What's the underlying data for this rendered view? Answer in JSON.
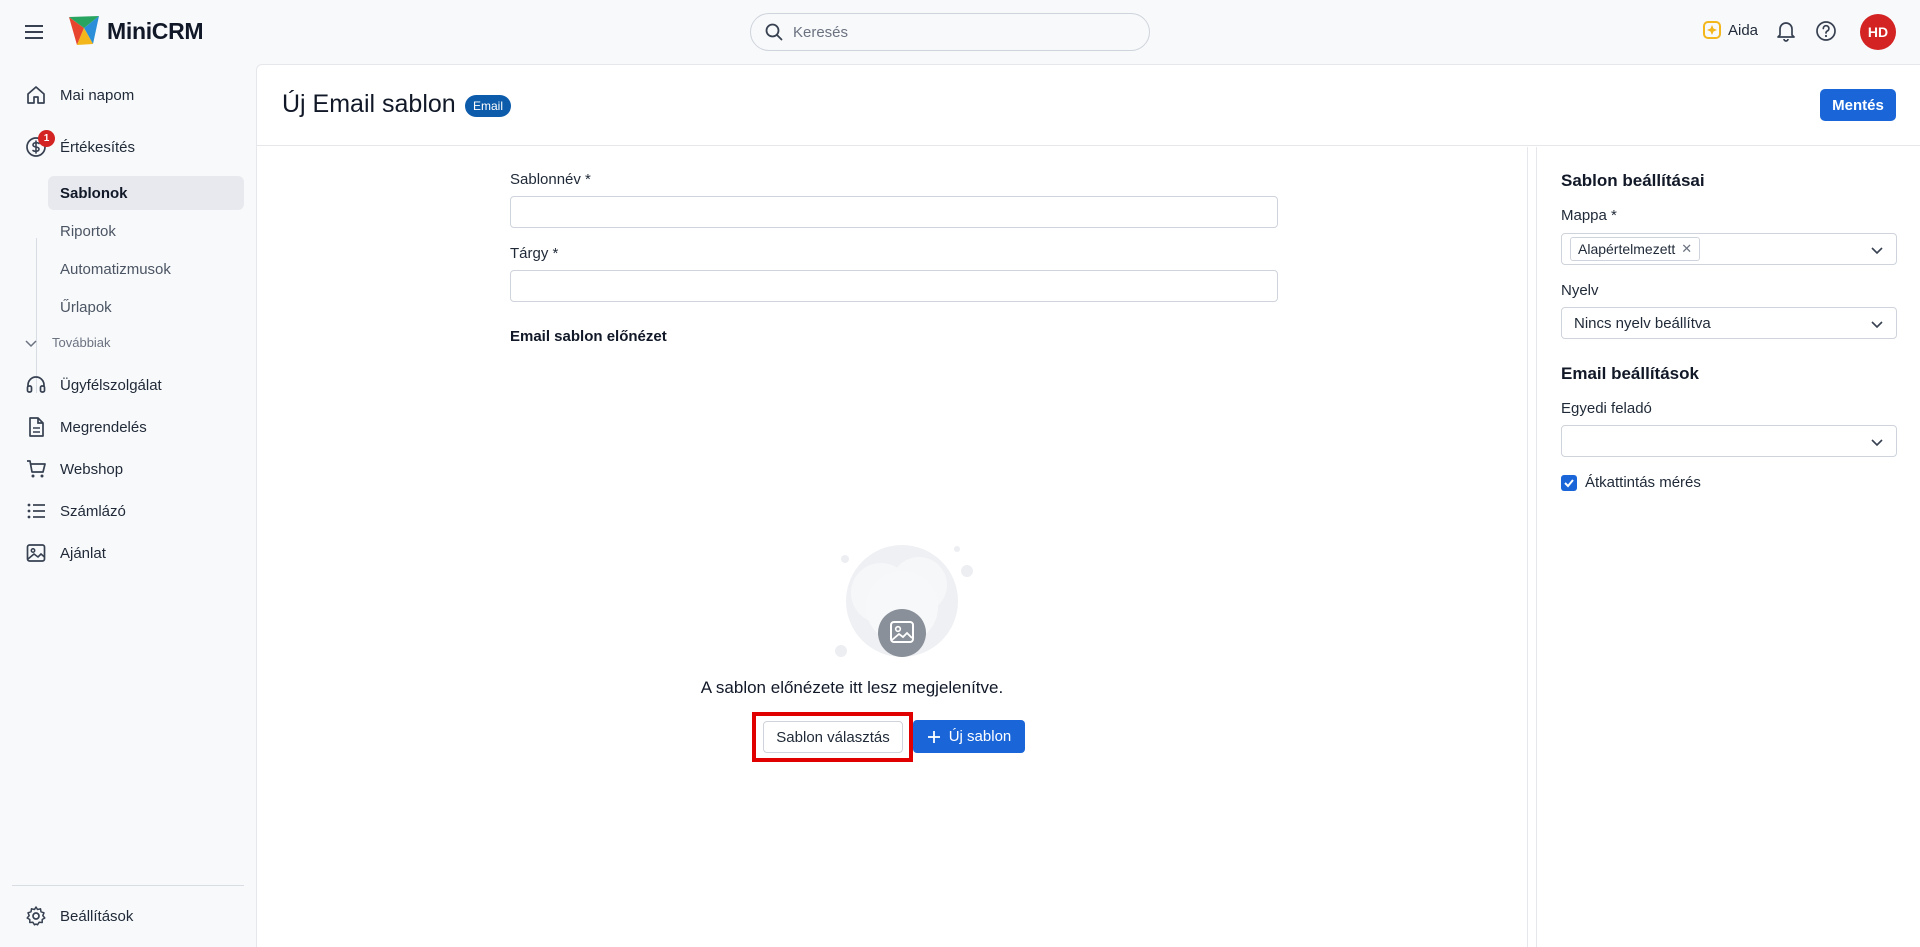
{
  "app": {
    "name": "MiniCRM"
  },
  "topbar": {
    "search_placeholder": "Keresés",
    "aida_label": "Aida",
    "avatar_initials": "HD"
  },
  "sidebar": {
    "items": [
      {
        "label": "Mai napom",
        "icon": "home-icon"
      },
      {
        "label": "Értékesítés",
        "icon": "dollar-circle-icon",
        "badge": "1"
      },
      {
        "label": "Ügyfélszolgálat",
        "icon": "headset-icon"
      },
      {
        "label": "Megrendelés",
        "icon": "document-icon"
      },
      {
        "label": "Webshop",
        "icon": "cart-icon"
      },
      {
        "label": "Számlázó",
        "icon": "list-icon"
      },
      {
        "label": "Ajánlat",
        "icon": "image-icon"
      }
    ],
    "sub_items": [
      {
        "label": "Sablonok",
        "active": true
      },
      {
        "label": "Riportok"
      },
      {
        "label": "Automatizmusok"
      },
      {
        "label": "Űrlapok"
      }
    ],
    "more_label": "Továbbiak",
    "settings_label": "Beállítások"
  },
  "page": {
    "title": "Új Email sablon",
    "type_badge": "Email",
    "save_label": "Mentés"
  },
  "form": {
    "name_label": "Sablonnév *",
    "name_value": "",
    "subject_label": "Tárgy *",
    "subject_value": "",
    "preview_label": "Email sablon előnézet",
    "empty_text": "A sablon előnézete itt lesz megjelenítve.",
    "pick_template_label": "Sablon választás",
    "new_template_label": "Új sablon"
  },
  "settings": {
    "template_settings_title": "Sablon beállításai",
    "folder_label": "Mappa *",
    "folder_value": "Alapértelmezett",
    "language_label": "Nyelv",
    "language_value": "Nincs nyelv beállítva",
    "email_settings_title": "Email beállítások",
    "sender_label": "Egyedi feladó",
    "sender_value": "",
    "click_tracking_label": "Átkattintás mérés",
    "click_tracking_checked": true
  },
  "colors": {
    "primary": "#1a66d9",
    "badge": "#0d5cab",
    "avatar": "#d32323",
    "highlight": "#e00000"
  }
}
